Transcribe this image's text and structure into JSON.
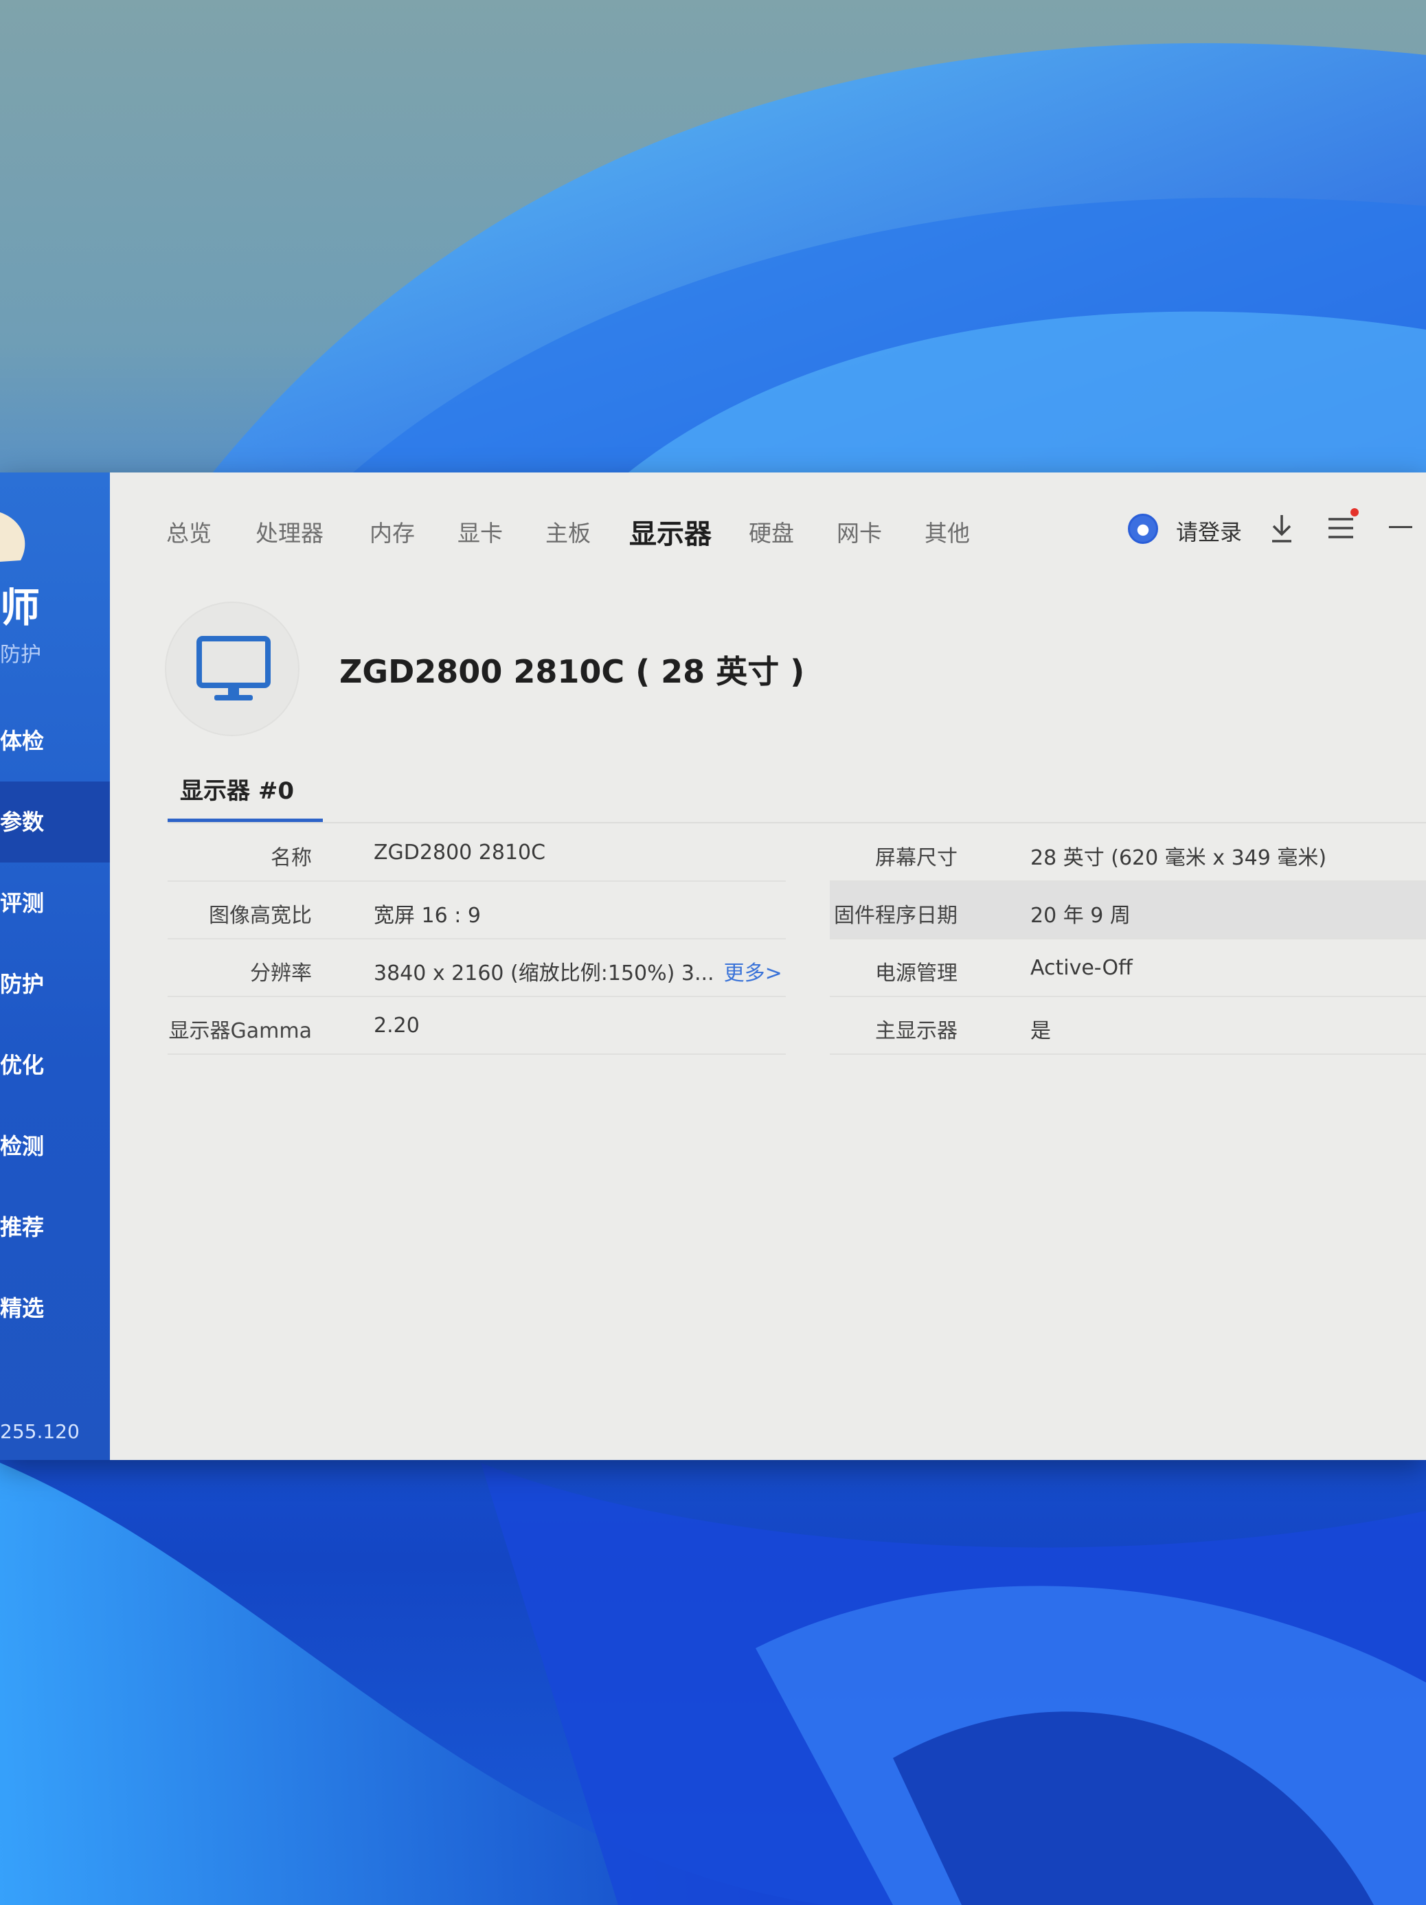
{
  "app": {
    "brand_text": "师",
    "brand_sub": "防护",
    "version": "255.120"
  },
  "sidebar": {
    "items": [
      {
        "label": "体检"
      },
      {
        "label": "参数"
      },
      {
        "label": "评测"
      },
      {
        "label": "防护"
      },
      {
        "label": "优化"
      },
      {
        "label": "检测"
      },
      {
        "label": "推荐"
      },
      {
        "label": "精选"
      }
    ],
    "active_index": 1
  },
  "tabs": [
    {
      "label": "总览"
    },
    {
      "label": "处理器"
    },
    {
      "label": "内存"
    },
    {
      "label": "显卡"
    },
    {
      "label": "主板"
    },
    {
      "label": "显示器"
    },
    {
      "label": "硬盘"
    },
    {
      "label": "网卡"
    },
    {
      "label": "其他"
    }
  ],
  "active_tab": "显示器",
  "header": {
    "login_label": "请登录",
    "icons": [
      "login-icon",
      "download-icon",
      "menu-icon",
      "minimize-icon"
    ]
  },
  "device": {
    "title": "ZGD2800 2810C ( 28 英寸 )",
    "icon": "monitor-icon"
  },
  "subtab": {
    "label": "显示器 #0"
  },
  "specs": {
    "left": [
      {
        "label": "名称",
        "value": "ZGD2800 2810C"
      },
      {
        "label": "图像高宽比",
        "value": "宽屏 16 : 9"
      },
      {
        "label": "分辨率",
        "value": "3840 x 2160 (缩放比例:150%) 3...",
        "more": "更多>"
      },
      {
        "label": "显示器Gamma",
        "value": "2.20"
      }
    ],
    "right": [
      {
        "label": "屏幕尺寸",
        "value": "28 英寸 (620 毫米 x 349 毫米)"
      },
      {
        "label": "固件程序日期",
        "value": "20 年 9 周"
      },
      {
        "label": "电源管理",
        "value": "Active-Off"
      },
      {
        "label": "主显示器",
        "value": "是"
      }
    ]
  },
  "colors": {
    "sidebar": "#1e57c6",
    "accent": "#2d63c8",
    "link": "#3a73d8",
    "notification": "#e4322b"
  }
}
